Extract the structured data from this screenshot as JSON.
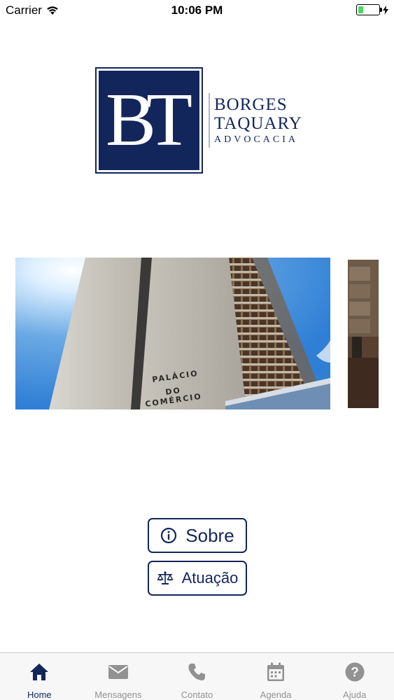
{
  "status_bar": {
    "carrier": "Carrier",
    "time": "10:06 PM",
    "battery_level": 0.25,
    "battery_color": "#4cd964"
  },
  "logo": {
    "monogram": "BT",
    "line1": "BORGES",
    "line2": "TAQUARY",
    "line3": "ADVOCACIA",
    "brand_color": "#13265c"
  },
  "carousel": {
    "slide1": {
      "building_sign_line1": "PALÁCIO",
      "building_sign_line2": "DO",
      "building_sign_line3": "COMÉRCIO"
    }
  },
  "buttons": {
    "sobre": {
      "label": "Sobre",
      "icon": "info-circle-icon"
    },
    "atuacao": {
      "label": "Atuação",
      "icon": "scales-icon"
    }
  },
  "tab_bar": {
    "active_color": "#13265c",
    "inactive_color": "#929292",
    "tabs": [
      {
        "label": "Home",
        "icon": "home-icon",
        "active": true
      },
      {
        "label": "Mensagens",
        "icon": "envelope-icon",
        "active": false
      },
      {
        "label": "Contato",
        "icon": "phone-icon",
        "active": false
      },
      {
        "label": "Agenda",
        "icon": "calendar-icon",
        "active": false
      },
      {
        "label": "Ajuda",
        "icon": "help-circle-icon",
        "active": false
      }
    ]
  }
}
